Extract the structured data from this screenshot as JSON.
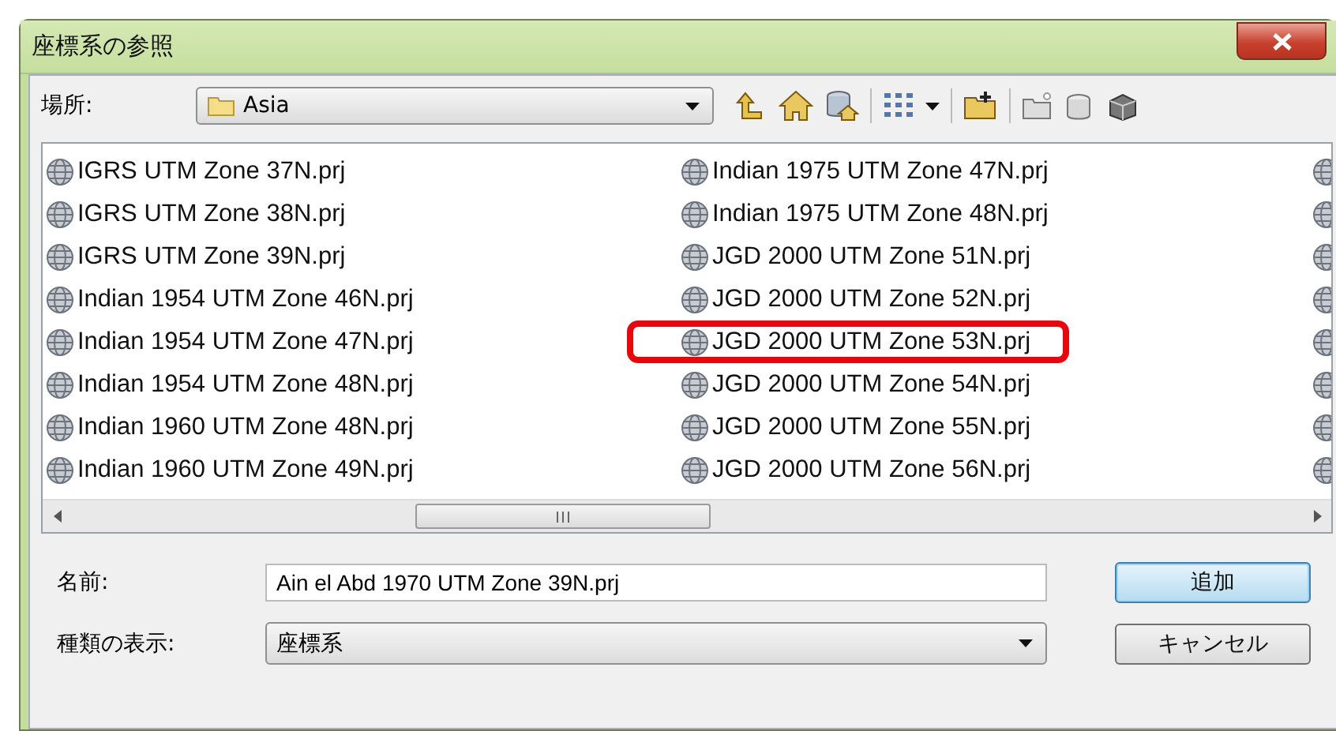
{
  "window": {
    "title": "座標系の参照"
  },
  "location": {
    "label": "場所:",
    "value": "Asia"
  },
  "files": {
    "columns": [
      [
        {
          "name": "IGRS UTM Zone 37N.prj",
          "highlighted": false
        },
        {
          "name": "IGRS UTM Zone 38N.prj",
          "highlighted": false
        },
        {
          "name": "IGRS UTM Zone 39N.prj",
          "highlighted": false
        },
        {
          "name": "Indian 1954 UTM Zone 46N.prj",
          "highlighted": false
        },
        {
          "name": "Indian 1954 UTM Zone 47N.prj",
          "highlighted": false
        },
        {
          "name": "Indian 1954 UTM Zone 48N.prj",
          "highlighted": false
        },
        {
          "name": "Indian 1960 UTM Zone 48N.prj",
          "highlighted": false
        },
        {
          "name": "Indian 1960 UTM Zone 49N.prj",
          "highlighted": false
        }
      ],
      [
        {
          "name": "Indian 1975 UTM Zone 47N.prj",
          "highlighted": false
        },
        {
          "name": "Indian 1975 UTM Zone 48N.prj",
          "highlighted": false
        },
        {
          "name": "JGD 2000 UTM Zone 51N.prj",
          "highlighted": false
        },
        {
          "name": "JGD 2000 UTM Zone 52N.prj",
          "highlighted": false
        },
        {
          "name": "JGD 2000 UTM Zone 53N.prj",
          "highlighted": true
        },
        {
          "name": "JGD 2000 UTM Zone 54N.prj",
          "highlighted": false
        },
        {
          "name": "JGD 2000 UTM Zone 55N.prj",
          "highlighted": false
        },
        {
          "name": "JGD 2000 UTM Zone 56N.prj",
          "highlighted": false
        }
      ]
    ],
    "partial_column": [
      {
        "kind": "file"
      },
      {
        "kind": "file"
      },
      {
        "kind": "file"
      },
      {
        "kind": "file"
      },
      {
        "kind": "file"
      },
      {
        "kind": "file"
      },
      {
        "kind": "file"
      },
      {
        "kind": "file"
      }
    ]
  },
  "name_field": {
    "label": "名前:",
    "value": "Ain el Abd 1970 UTM Zone 39N.prj"
  },
  "type_field": {
    "label": "種類の表示:",
    "value": "座標系"
  },
  "buttons": [
    {
      "label": "追加",
      "default": true
    },
    {
      "label": "キャンセル",
      "default": false
    }
  ]
}
